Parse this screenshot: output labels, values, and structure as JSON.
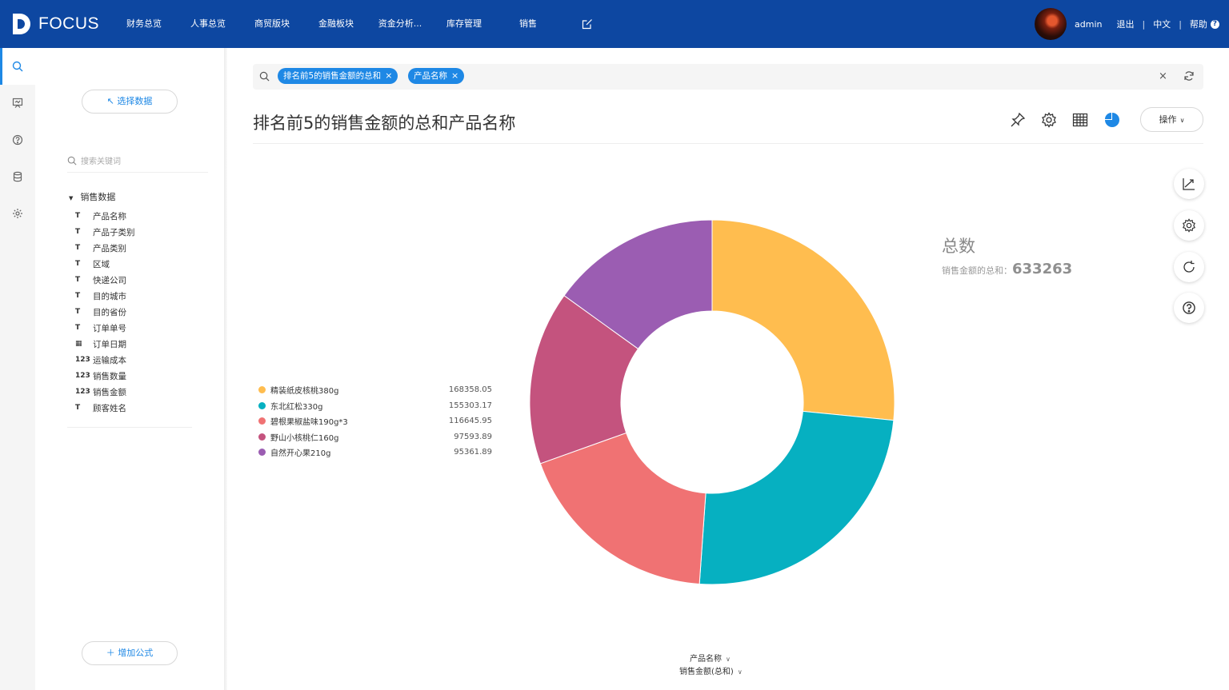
{
  "app": {
    "logo_text": "FOCUS"
  },
  "nav": {
    "items": [
      "财务总览",
      "人事总览",
      "商贸版块",
      "金融板块",
      "资金分析...",
      "库存管理",
      "销售"
    ],
    "edit_icon": "edit-icon"
  },
  "user": {
    "name": "admin",
    "logout": "退出",
    "language": "中文",
    "help": "帮助",
    "help_glyph": "?"
  },
  "rail": {
    "icons": [
      "search-icon",
      "board-icon",
      "help-icon",
      "database-icon",
      "settings-icon"
    ]
  },
  "panel": {
    "select_data": "↖ 选择数据",
    "search_placeholder": "搜索关键词",
    "tree_root": "销售数据",
    "fields": [
      {
        "type": "text",
        "icon": "T",
        "label": "产品名称"
      },
      {
        "type": "text",
        "icon": "T",
        "label": "产品子类别"
      },
      {
        "type": "text",
        "icon": "T",
        "label": "产品类别"
      },
      {
        "type": "text",
        "icon": "T",
        "label": "区域"
      },
      {
        "type": "text",
        "icon": "T",
        "label": "快递公司"
      },
      {
        "type": "text",
        "icon": "T",
        "label": "目的城市"
      },
      {
        "type": "text",
        "icon": "T",
        "label": "目的省份"
      },
      {
        "type": "text",
        "icon": "T",
        "label": "订单单号"
      },
      {
        "type": "date",
        "icon": "▦",
        "label": "订单日期"
      },
      {
        "type": "number",
        "icon": "123",
        "label": "运输成本"
      },
      {
        "type": "number",
        "icon": "123",
        "label": "销售数量"
      },
      {
        "type": "number",
        "icon": "123",
        "label": "销售金额"
      },
      {
        "type": "text",
        "icon": "T",
        "label": "顾客姓名"
      }
    ],
    "add_formula": "＋ 增加公式"
  },
  "search": {
    "chips": [
      "排名前5的销售金额的总和",
      "产品名称"
    ],
    "close": "×"
  },
  "header": {
    "title": "排名前5的销售金额的总和产品名称",
    "operate": "操作"
  },
  "summary": {
    "title": "总数",
    "label": "销售金额的总和：",
    "value": "633263"
  },
  "axis": {
    "category": "产品名称",
    "measure": "销售金额(总和)"
  },
  "chart_data": {
    "type": "pie",
    "donut": true,
    "categories": [
      "精装纸皮核桃380g",
      "东北红松330g",
      "碧根果椒盐味190g*3",
      "野山小核桃仁160g",
      "自然开心果210g"
    ],
    "values": [
      168358.05,
      155303.17,
      116645.95,
      97593.89,
      95361.89
    ],
    "labels": [
      "168358.05",
      "155303.17",
      "116645.95",
      "97593.89",
      "95361.89"
    ],
    "colors": [
      "#ffbd4f",
      "#06b0c1",
      "#f07273",
      "#c4537e",
      "#9b5db2"
    ],
    "legend": "left"
  }
}
